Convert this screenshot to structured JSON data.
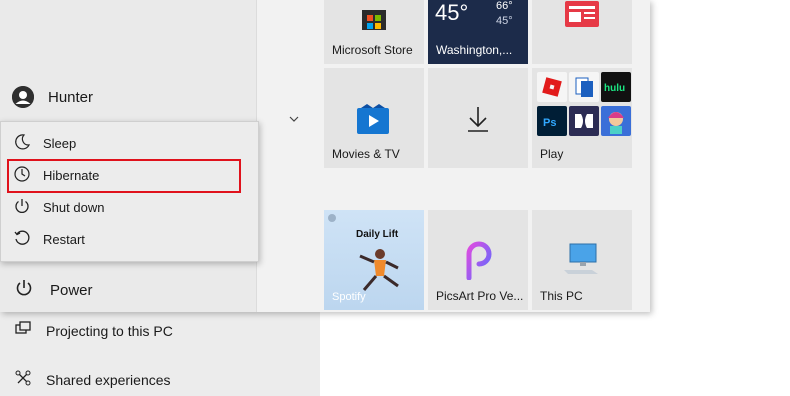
{
  "settings": {
    "items": [
      {
        "label": "Projecting to this PC",
        "icon": "projector-icon"
      },
      {
        "label": "Shared experiences",
        "icon": "share-icon"
      }
    ]
  },
  "start_menu": {
    "user": {
      "name": "Hunter"
    },
    "power": {
      "label": "Power"
    }
  },
  "power_menu": {
    "items": [
      {
        "label": "Sleep",
        "icon": "moon-icon"
      },
      {
        "label": "Hibernate",
        "icon": "clock-icon"
      },
      {
        "label": "Shut down",
        "icon": "power-icon"
      },
      {
        "label": "Restart",
        "icon": "restart-icon"
      }
    ],
    "highlight_color": "#e0121c"
  },
  "tiles": {
    "store": {
      "label": "Microsoft Store"
    },
    "weather": {
      "temp": "45°",
      "high": "66°",
      "low": "45°",
      "city": "Washington,..."
    },
    "movies": {
      "label": "Movies & TV"
    },
    "play": {
      "label": "Play"
    },
    "spotify": {
      "title": "Daily Lift",
      "label": "Spotify"
    },
    "picsart": {
      "label": "PicsArt Pro Ve..."
    },
    "thispc": {
      "label": "This PC"
    }
  }
}
